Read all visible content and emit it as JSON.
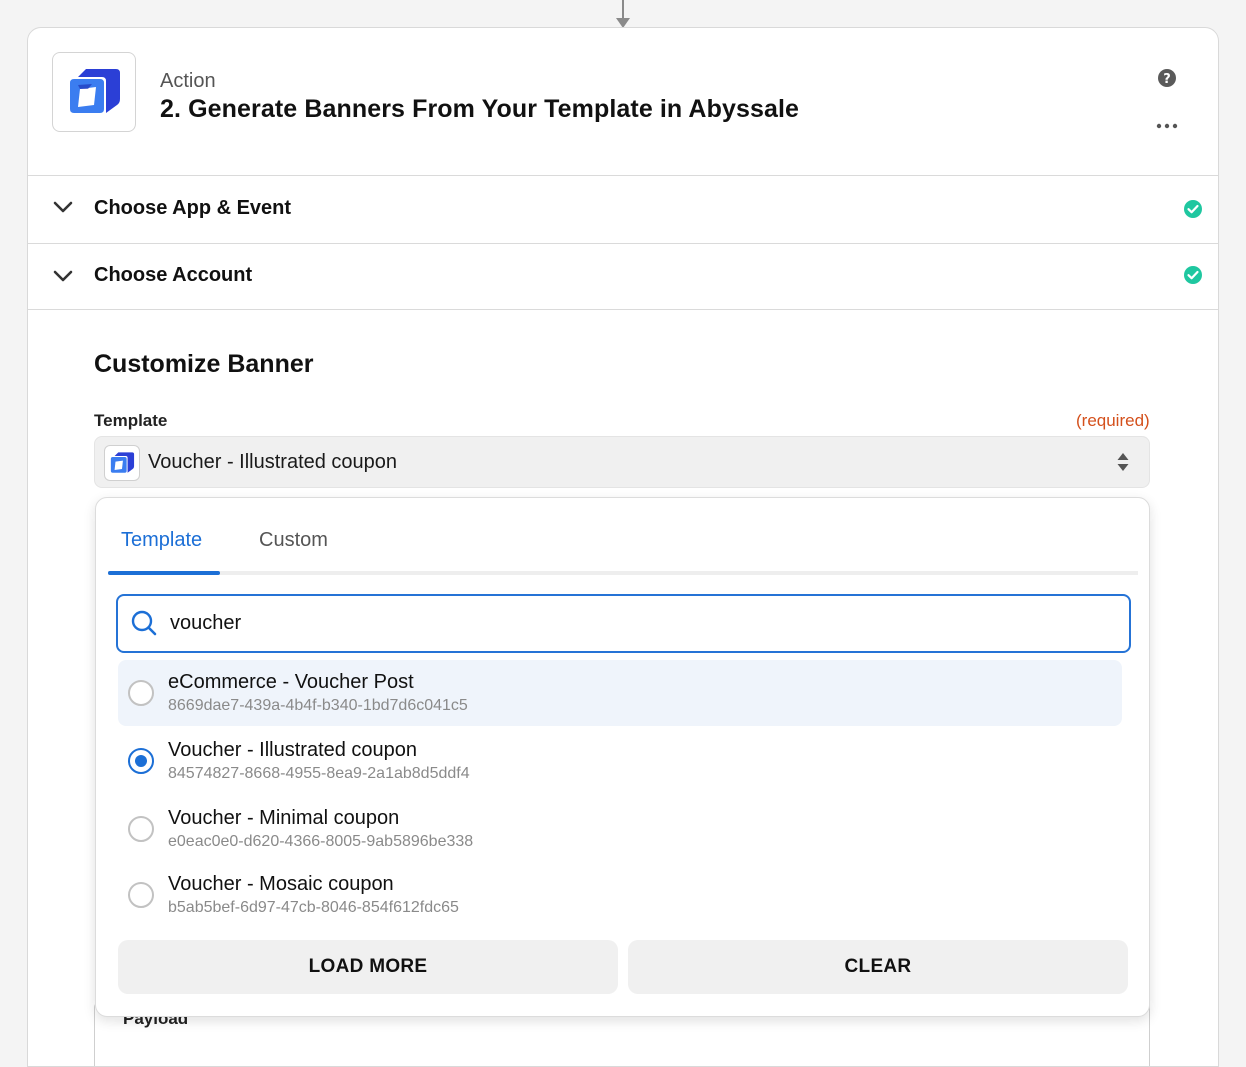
{
  "step": {
    "kind": "Action",
    "title": "2. Generate Banners From Your Template in Abyssale",
    "help_icon": "help-circle-icon",
    "more_icon": "more-horizontal-icon"
  },
  "sections": [
    {
      "label": "Choose App & Event",
      "status": "complete"
    },
    {
      "label": "Choose Account",
      "status": "complete"
    }
  ],
  "customize": {
    "heading": "Customize Banner",
    "template_field": {
      "label": "Template",
      "required_text": "(required)",
      "selected_value": "Voucher - Illustrated coupon"
    }
  },
  "dropdown": {
    "tabs": [
      {
        "label": "Template",
        "active": true
      },
      {
        "label": "Custom",
        "active": false
      }
    ],
    "search": {
      "value": "voucher",
      "placeholder": ""
    },
    "options": [
      {
        "title": "eCommerce - Voucher Post",
        "id": "8669dae7-439a-4b4f-b340-1bd7d6c041c5",
        "selected": false
      },
      {
        "title": "Voucher - Illustrated coupon",
        "id": "84574827-8668-4955-8ea9-2a1ab8d5ddf4",
        "selected": true
      },
      {
        "title": "Voucher - Minimal coupon",
        "id": "e0eac0e0-d620-4366-8005-9ab5896be338",
        "selected": false
      },
      {
        "title": "Voucher - Mosaic coupon",
        "id": "b5ab5bef-6d97-47cb-8046-854f612fdc65",
        "selected": false
      }
    ],
    "load_more_label": "LOAD MORE",
    "clear_label": "CLEAR"
  },
  "payload": {
    "label": "Payload"
  },
  "colors": {
    "accent": "#1c6fd6",
    "success": "#1fc7a0",
    "required": "#d4501c",
    "brand": "#2a3fd9"
  }
}
